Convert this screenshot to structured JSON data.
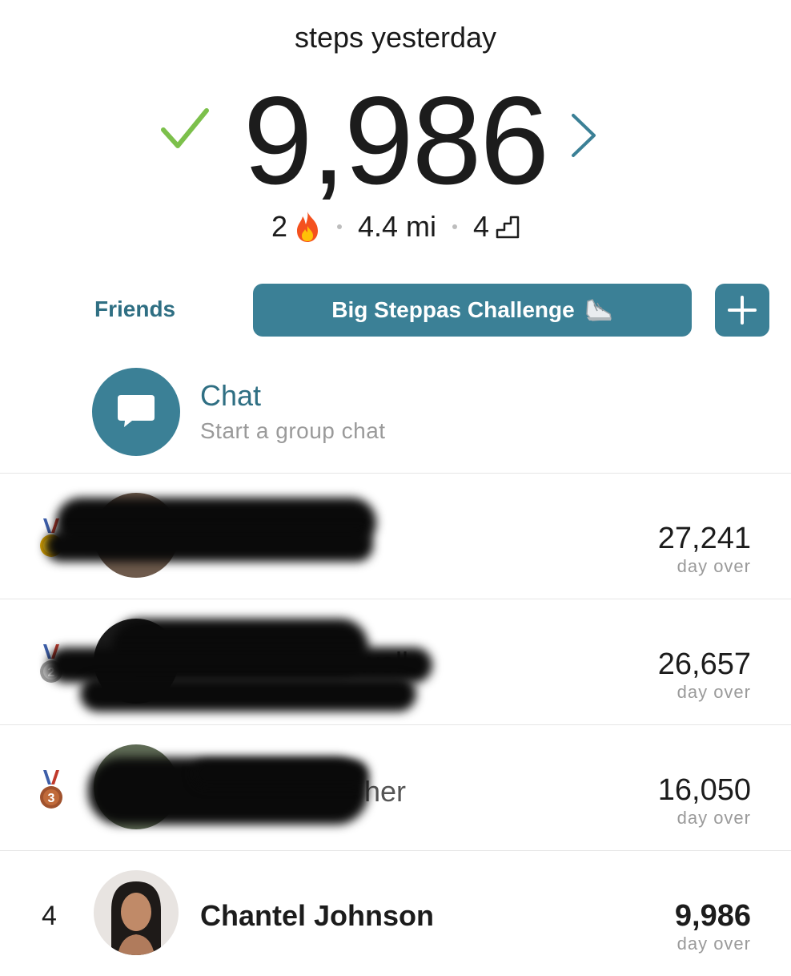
{
  "header": {
    "label": "steps yesterday",
    "steps": "9,986",
    "streak": "2",
    "distance": "4.4 mi",
    "floors": "4"
  },
  "tabs": {
    "friends": "Friends",
    "challenge": "Big Steppas Challenge"
  },
  "chat": {
    "title": "Chat",
    "subtitle": "Start a group chat"
  },
  "leaderboard": [
    {
      "rank": "1",
      "name": "",
      "steps": "27,241",
      "sub": "day over"
    },
    {
      "rank": "2",
      "name": "well",
      "steps": "26,657",
      "sub": "day over"
    },
    {
      "rank": "3",
      "name": "her",
      "steps": "16,050",
      "sub": "day over"
    },
    {
      "rank": "4",
      "name": "Chantel Johnson",
      "steps": "9,986",
      "sub": "day over"
    }
  ],
  "colors": {
    "accent": "#3b8096",
    "accent_text": "#2f6f83",
    "check": "#7cc04b"
  }
}
